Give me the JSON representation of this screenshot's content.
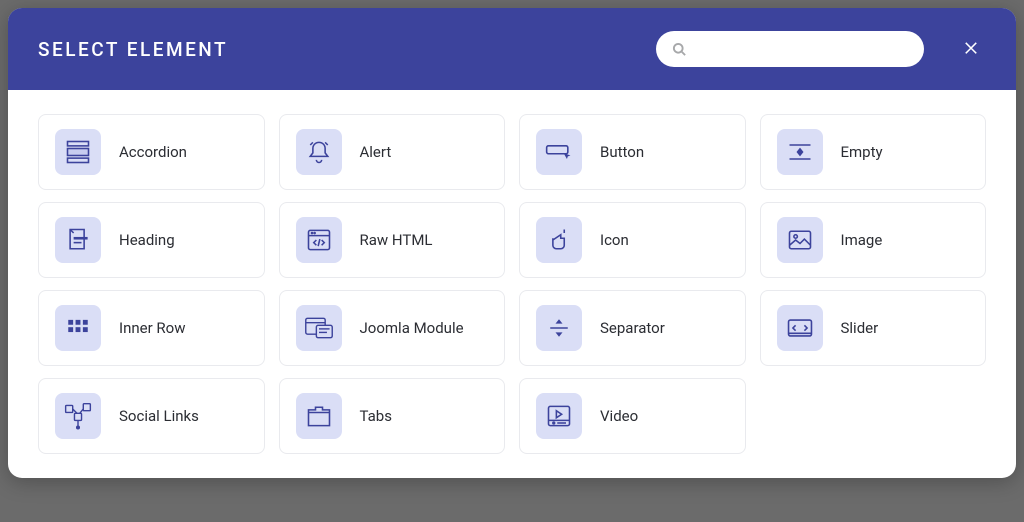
{
  "header": {
    "title": "SELECT ELEMENT",
    "search_placeholder": ""
  },
  "elements": [
    {
      "id": "accordion",
      "label": "Accordion",
      "icon": "accordion-icon"
    },
    {
      "id": "alert",
      "label": "Alert",
      "icon": "alert-icon"
    },
    {
      "id": "button",
      "label": "Button",
      "icon": "button-icon"
    },
    {
      "id": "empty",
      "label": "Empty",
      "icon": "empty-icon"
    },
    {
      "id": "heading",
      "label": "Heading",
      "icon": "heading-icon"
    },
    {
      "id": "raw-html",
      "label": "Raw HTML",
      "icon": "raw-html-icon"
    },
    {
      "id": "icon",
      "label": "Icon",
      "icon": "icon-icon"
    },
    {
      "id": "image",
      "label": "Image",
      "icon": "image-icon"
    },
    {
      "id": "inner-row",
      "label": "Inner Row",
      "icon": "inner-row-icon"
    },
    {
      "id": "joomla-module",
      "label": "Joomla Module",
      "icon": "joomla-module-icon"
    },
    {
      "id": "separator",
      "label": "Separator",
      "icon": "separator-icon"
    },
    {
      "id": "slider",
      "label": "Slider",
      "icon": "slider-icon"
    },
    {
      "id": "social-links",
      "label": "Social Links",
      "icon": "social-links-icon"
    },
    {
      "id": "tabs",
      "label": "Tabs",
      "icon": "tabs-icon"
    },
    {
      "id": "video",
      "label": "Video",
      "icon": "video-icon"
    }
  ],
  "colors": {
    "brand": "#3c439c",
    "icon_bg": "#dadef6",
    "card_border": "#e9eaee"
  }
}
